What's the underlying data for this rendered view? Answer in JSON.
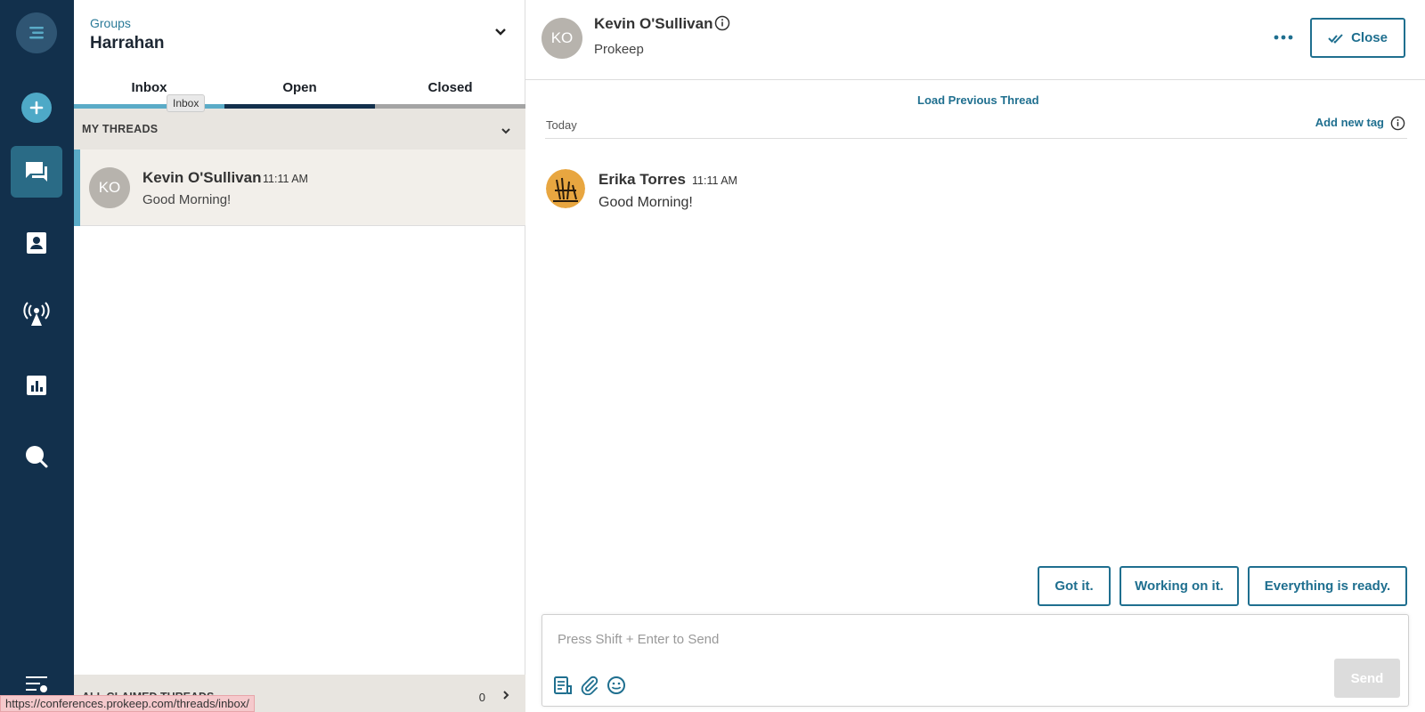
{
  "nav": {
    "items": [
      {
        "icon": "menu-logo-icon"
      },
      {
        "icon": "plus-icon"
      },
      {
        "icon": "chat-icon",
        "active": true
      },
      {
        "icon": "contacts-icon"
      },
      {
        "icon": "broadcast-icon"
      },
      {
        "icon": "analytics-icon"
      },
      {
        "icon": "search-icon"
      },
      {
        "icon": "settings-icon"
      }
    ]
  },
  "threads_panel": {
    "group_label": "Groups",
    "group_name": "Harrahan",
    "tabs": [
      {
        "label": "Inbox",
        "bar_color": "#5aabc7"
      },
      {
        "label": "Open",
        "bar_color": "#12304c"
      },
      {
        "label": "Closed",
        "bar_color": "#a4a4a4"
      }
    ],
    "tooltip": "Inbox",
    "my_threads_header": "MY THREADS",
    "thread": {
      "initials": "KO",
      "name": "Kevin O'Sullivan",
      "time": "11:11 AM",
      "preview": "Good Morning!"
    },
    "all_claimed_header": "ALL CLAIMED THREADS",
    "all_claimed_count": "0"
  },
  "status_bar_url": "https://conferences.prokeep.com/threads/inbox/",
  "conversation": {
    "contact_initials": "KO",
    "contact_name": "Kevin O'Sullivan",
    "contact_org": "Prokeep",
    "close_label": "Close",
    "load_previous": "Load Previous Thread",
    "day_label": "Today",
    "add_tag": "Add new tag",
    "message": {
      "sender": "Erika Torres",
      "time": "11:11 AM",
      "text": "Good Morning!"
    },
    "quick_replies": [
      "Got it.",
      "Working on it.",
      "Everything is ready."
    ],
    "composer_placeholder": "Press Shift + Enter to Send",
    "send_label": "Send"
  },
  "colors": {
    "rail": "#12304c",
    "accent": "#1f6f8f",
    "inbox_bar": "#5aabc7"
  }
}
